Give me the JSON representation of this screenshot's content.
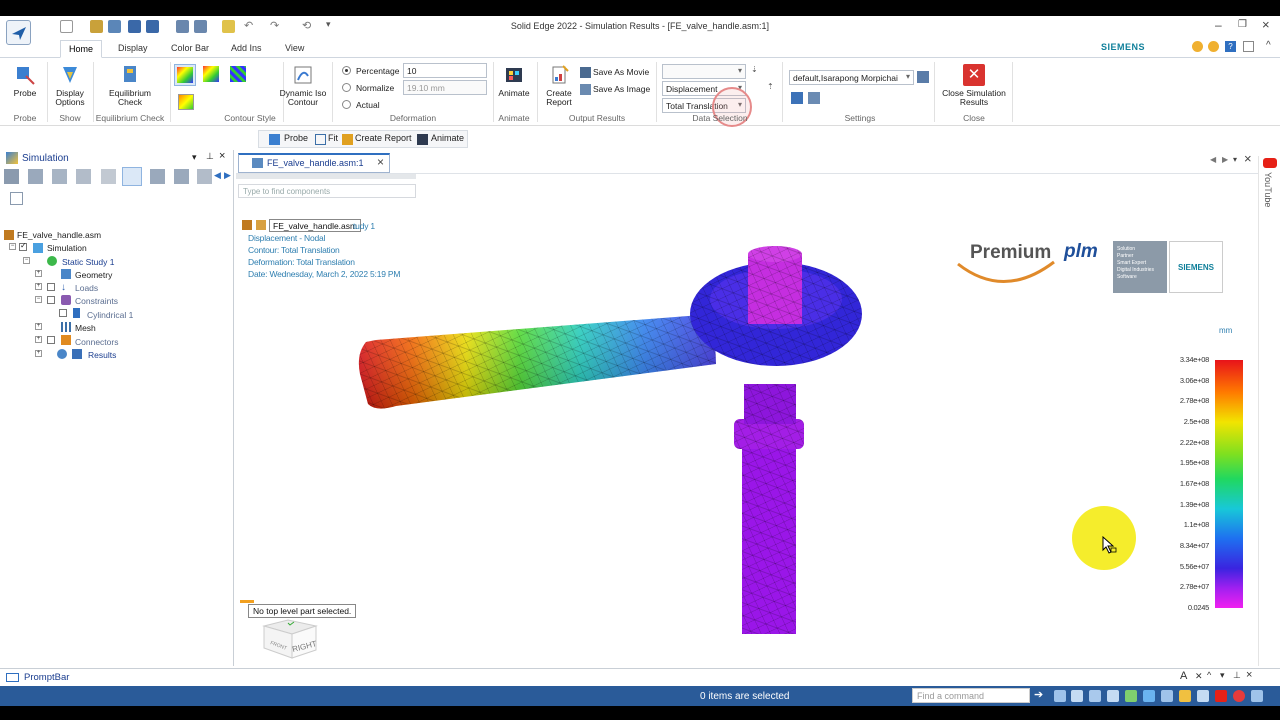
{
  "window": {
    "title": "Solid Edge 2022 - Simulation Results - [FE_valve_handle.asm:1]",
    "brand": "SIEMENS"
  },
  "tabs": [
    "Home",
    "Display",
    "Color Bar",
    "Add Ins",
    "View"
  ],
  "ribbon": {
    "probe": {
      "label1": "Probe",
      "group": "Probe"
    },
    "display_options": {
      "label1": "Display",
      "label2": "Options",
      "group": "Show"
    },
    "equilibrium": {
      "label1": "Equilibrium",
      "label2": "Check",
      "group": "Equilibrium Check"
    },
    "contour_group": "Contour Style",
    "dynamic_iso": {
      "label1": "Dynamic Iso",
      "label2": "Contour"
    },
    "deformation": {
      "group": "Deformation",
      "percentage_label": "Percentage",
      "percentage_value": "10",
      "normalize_label": "Normalize",
      "normalize_value": "19.10 mm",
      "actual_label": "Actual"
    },
    "animate": {
      "label": "Animate",
      "group": "Animate"
    },
    "output": {
      "create_report1": "Create",
      "create_report2": "Report",
      "save_movie": "Save As Movie",
      "save_image": "Save As Image",
      "group": "Output Results"
    },
    "data_selection": {
      "result_type": "Displacement",
      "component": "Total Translation",
      "group": "Data Selection"
    },
    "settings": {
      "value": "default,Isarapong Morpichai",
      "group": "Settings"
    },
    "close": {
      "label1": "Close Simulation",
      "label2": "Results",
      "group": "Close"
    }
  },
  "command_bar": {
    "probe": "Probe",
    "fit": "Fit",
    "create_report": "Create Report",
    "animate": "Animate"
  },
  "left_panel": {
    "title": "Simulation",
    "tree": {
      "root": "FE_valve_handle.asm",
      "simulation": "Simulation",
      "study": "Static Study 1",
      "geometry": "Geometry",
      "loads": "Loads",
      "constraints": "Constraints",
      "cylindrical": "Cylindrical 1",
      "mesh": "Mesh",
      "connectors": "Connectors",
      "results": "Results"
    }
  },
  "document_tab": "FE_valve_handle.asm:1",
  "viewport": {
    "search_placeholder": "Type to find components",
    "tooltip": "FE_valve_handle.asm",
    "study_suffix": "tudy 1",
    "info": {
      "line1": "Displacement - Nodal",
      "line2": "Contour: Total Translation",
      "line3": "Deformation: Total Translation",
      "line4": "Date: Wednesday, March 2, 2022   5:19 PM"
    },
    "selection_msg": "No top level part selected.",
    "view_cube": {
      "front": "FRONT",
      "right": "RIGHT"
    },
    "logo": {
      "premium": "Premium",
      "plm": "plm",
      "partner_line1": "Solution",
      "partner_line2": "Partner",
      "partner_line3": "Smart Expert",
      "partner_line4": "Digital Industries",
      "partner_line5": "Software",
      "siemens": "SIEMENS"
    },
    "color_bar": {
      "unit": "mm",
      "labels": [
        "3.34e+08",
        "3.06e+08",
        "2.78e+08",
        "2.5e+08",
        "2.22e+08",
        "1.95e+08",
        "1.67e+08",
        "1.39e+08",
        "1.1e+08",
        "8.34e+07",
        "5.56e+07",
        "2.78e+07",
        "0.0245"
      ]
    }
  },
  "right_rail": {
    "youtube": "YouTube"
  },
  "prompt_bar": "PromptBar",
  "status": {
    "text": "0 items are selected",
    "find_placeholder": "Find a command"
  },
  "colors": {
    "accent": "#2a5b99",
    "info_text": "#2f7fb0",
    "close_red": "#d9332f"
  }
}
